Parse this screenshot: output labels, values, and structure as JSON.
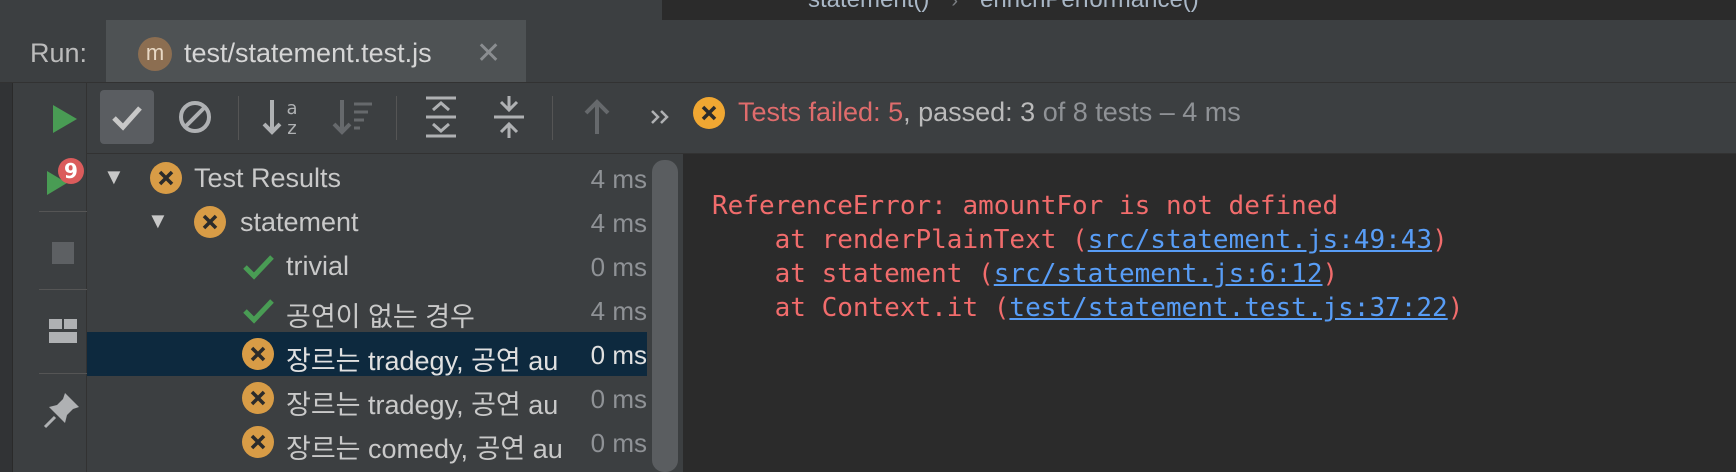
{
  "breadcrumb": [
    "statement()",
    "enrichPerformance()"
  ],
  "run_panel": {
    "label": "Run:",
    "tab": {
      "avatar_letter": "m",
      "title": "test/statement.test.js"
    }
  },
  "left_toolbar": [
    "rerun-icon",
    "rerun-failed-icon",
    "stop-icon",
    "layout-icon",
    "pin-icon"
  ],
  "toolbar": {
    "buttons": [
      "show-passed-icon",
      "show-ignored-icon",
      "sort-alphabetically-icon",
      "sort-by-duration-icon",
      "expand-all-icon",
      "collapse-all-icon",
      "previous-failed-icon",
      "more-icon"
    ],
    "status": {
      "failed_text": "Tests failed: 5",
      "passed_text": ", passed: 3",
      "rest_text": " of 8 tests – 4 ms"
    }
  },
  "tree": [
    {
      "label": "Test Results",
      "time": "4 ms",
      "status": "failed",
      "expanded": true
    },
    {
      "label": "statement",
      "time": "4 ms",
      "status": "failed",
      "expanded": true
    },
    {
      "label": "trivial",
      "time": "0 ms",
      "status": "passed"
    },
    {
      "label": "공연이 없는 경우",
      "time": "4 ms",
      "status": "passed"
    },
    {
      "label": "장르는 tradegy, 공연 au",
      "time": "0 ms",
      "status": "failed",
      "selected": true
    },
    {
      "label": "장르는 tradegy, 공연 au",
      "time": "0 ms",
      "status": "failed"
    },
    {
      "label": "장르는 comedy, 공연 au",
      "time": "0 ms",
      "status": "failed"
    }
  ],
  "console": {
    "error": "ReferenceError: amountFor is not defined",
    "stack": [
      {
        "prefix": "    at renderPlainText (",
        "link": "src/statement.js:49:43",
        "suffix": ")"
      },
      {
        "prefix": "    at statement (",
        "link": "src/statement.js:6:12",
        "suffix": ")"
      },
      {
        "prefix": "    at Context.it (",
        "link": "test/statement.test.js:37:22",
        "suffix": ")"
      }
    ]
  },
  "colors": {
    "fail": "#e06c6c",
    "pass": "#499c54",
    "link": "#589df6",
    "selection": "#0d293e",
    "warn_icon": "#f0a732"
  }
}
